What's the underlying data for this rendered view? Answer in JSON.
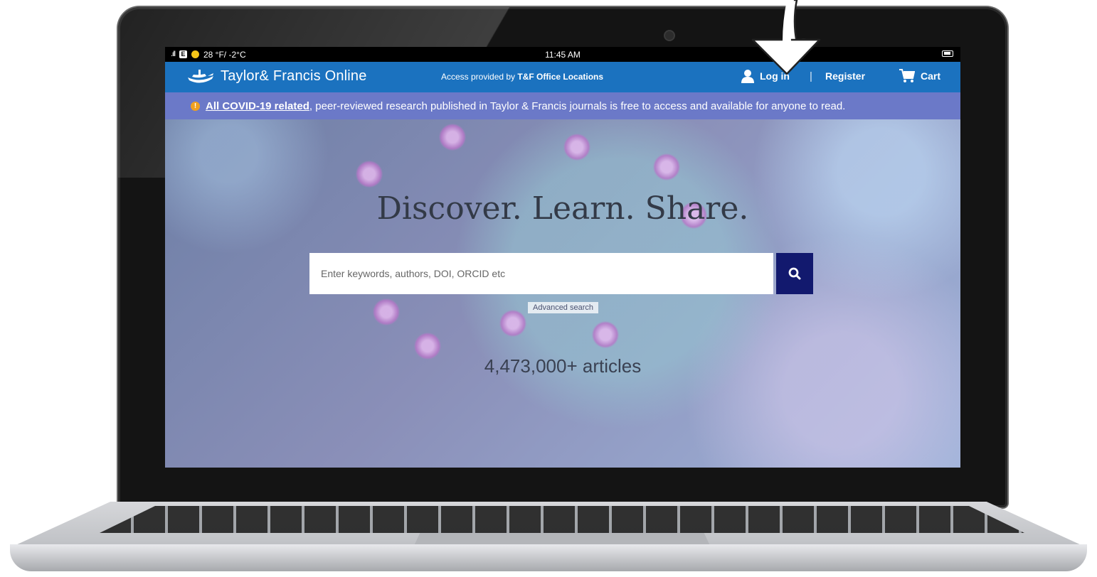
{
  "status_bar": {
    "signal": ".ıll",
    "e_badge": "E",
    "weather": "28 °F/ -2°C",
    "time": "11:45 AM"
  },
  "header": {
    "logo_text": "Taylor& Francis Online",
    "access_prefix": "Access provided by ",
    "access_org": "T&F Office Locations",
    "login_label": "Log in",
    "separator": "|",
    "register_label": "Register",
    "cart_label": "Cart"
  },
  "banner": {
    "link_text": "All COVID-19 related",
    "rest_text": ", peer-reviewed research published in Taylor & Francis journals is free to access and available for anyone to read."
  },
  "hero": {
    "title": "Discover. Learn. Share.",
    "search_placeholder": "Enter keywords, authors, DOI, ORCID etc",
    "advanced_search": "Advanced search",
    "article_count": "4,473,000+ articles"
  },
  "icons": {
    "logo": "lamp-icon",
    "login": "user-icon",
    "cart": "cart-icon",
    "search": "search-icon",
    "warning": "warning-icon",
    "annotation": "arrow-pointer-icon"
  },
  "colors": {
    "header_blue": "#1b72bf",
    "banner_purple": "#6b79c8",
    "search_button": "#12196e",
    "warning": "#f0a020"
  }
}
